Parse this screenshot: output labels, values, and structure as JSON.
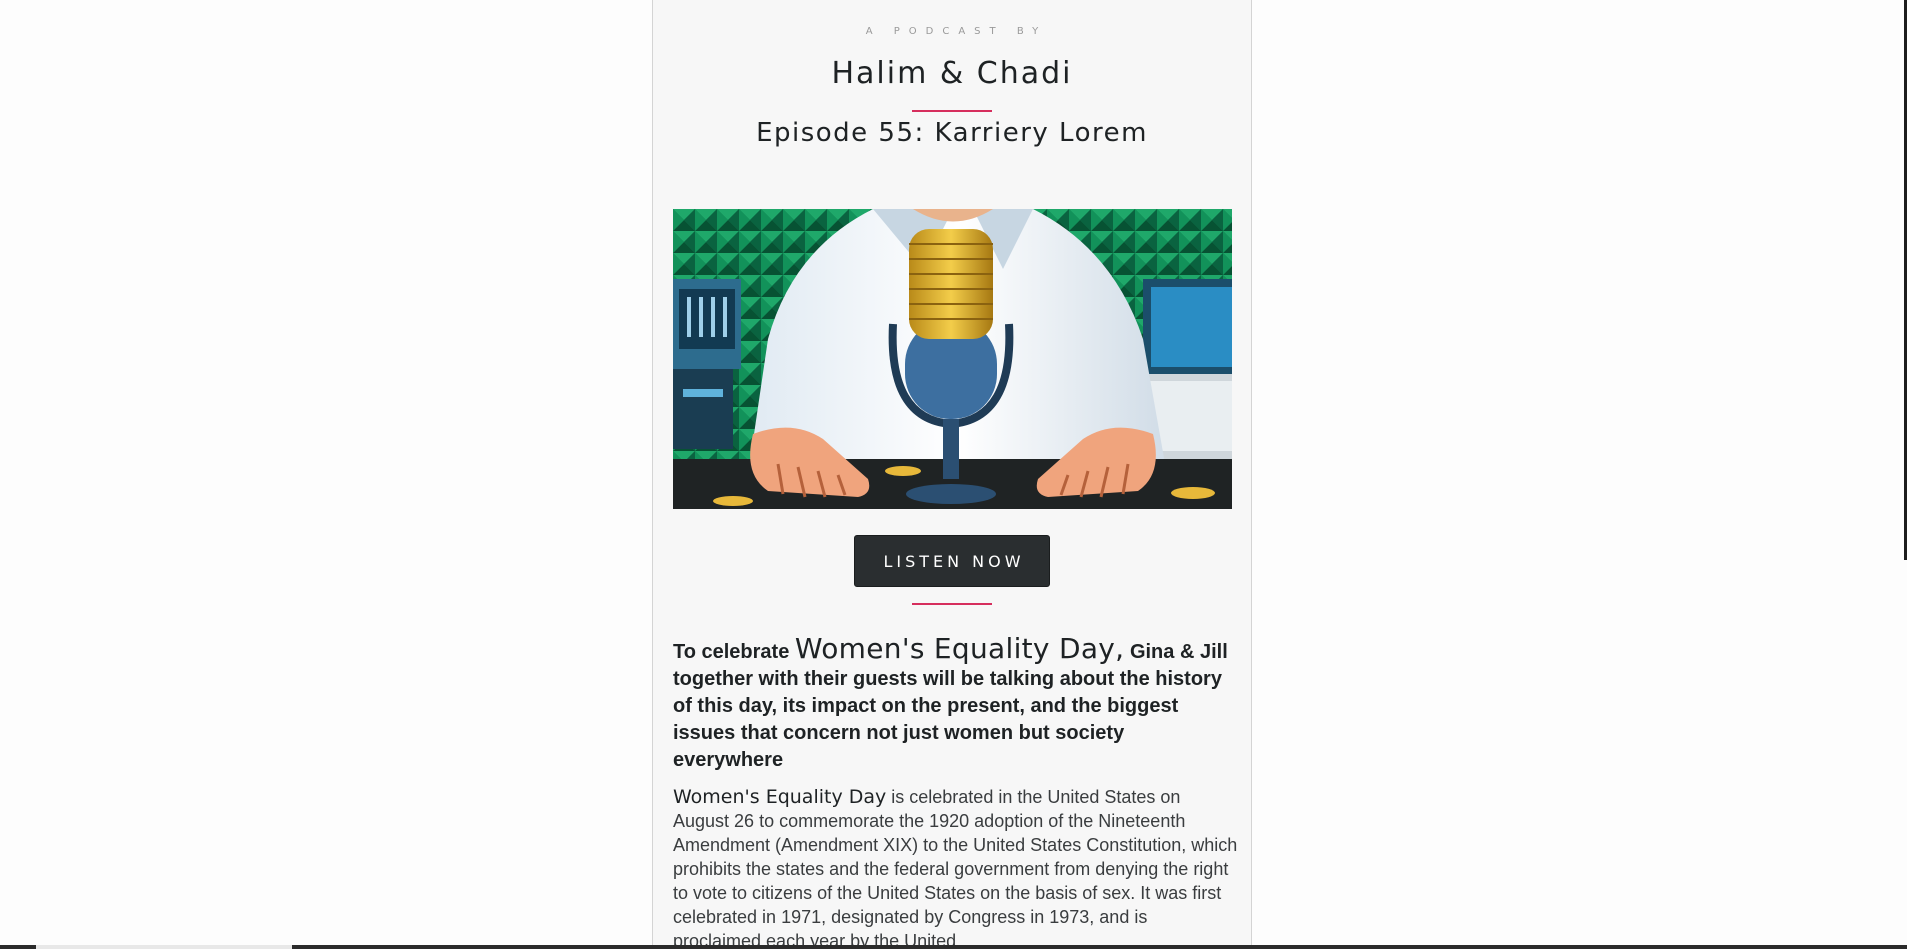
{
  "header": {
    "eyebrow": "A PODCAST BY",
    "show_title": "Halim & Chadi",
    "episode_title": "Episode 55: Karriery Lorem"
  },
  "cover_image": {
    "alt": "Podcast cover illustration"
  },
  "cta": {
    "listen_label": "LISTEN NOW"
  },
  "lead": {
    "pre": "To celebrate ",
    "highlight": "Women's Equality Day,",
    "post": " Gina & Jill together with their guests will be talking about the history of this day, its impact on the present, and the biggest issues that concern not just women but society everywhere"
  },
  "body": {
    "term": "Women's Equality Day",
    "text": " is celebrated in the United States on August 26 to commemorate the 1920 adoption of the Nineteenth Amendment (Amendment XIX) to the United States Constitution, which prohibits the states and the federal government from denying the right to vote to citizens of the United States on the basis of sex. It was first celebrated in 1971, designated by Congress in 1973, and is proclaimed each year by the United"
  },
  "colors": {
    "accent": "#d62e5d",
    "button_bg": "#2a2e30",
    "text": "#1e2224",
    "column_bg": "#f7f7f7"
  }
}
